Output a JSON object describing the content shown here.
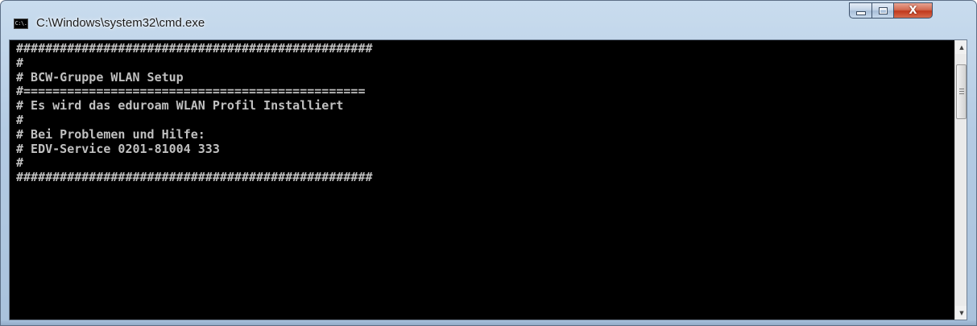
{
  "window": {
    "title": "C:\\Windows\\system32\\cmd.exe",
    "icon": "cmd-icon",
    "icon_text": "C:\\."
  },
  "controls": {
    "minimize_icon": "minimize-icon",
    "maximize_icon": "maximize-icon",
    "close_icon": "close-icon",
    "close_glyph": "X"
  },
  "console": {
    "lines": [
      "#################################################",
      "#",
      "# BCW-Gruppe WLAN Setup",
      "#===============================================",
      "# Es wird das eduroam WLAN Profil Installiert",
      "#",
      "# Bei Problemen und Hilfe:",
      "# EDV-Service 0201-81004 333",
      "#",
      "#################################################"
    ],
    "text_color": "#c0c0c0",
    "background_color": "#000000"
  },
  "scrollbar": {
    "up_arrow": "▲",
    "down_arrow": "▼"
  }
}
